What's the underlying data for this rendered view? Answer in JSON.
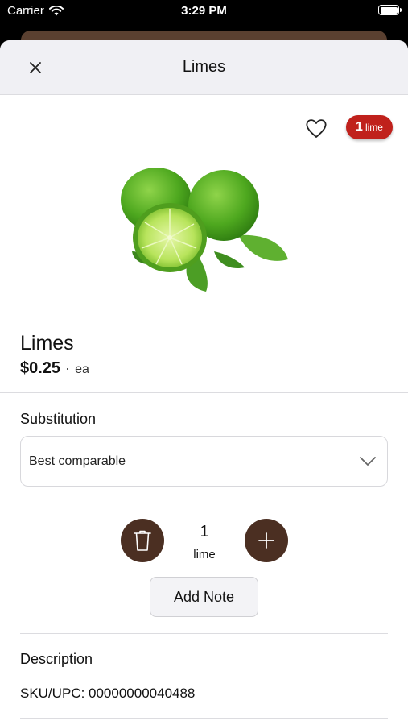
{
  "status_bar": {
    "carrier": "Carrier",
    "time": "3:29 PM"
  },
  "nav": {
    "title": "Limes"
  },
  "cart_badge": {
    "count": "1",
    "unit": "lime",
    "color": "#c0211c"
  },
  "product": {
    "name": "Limes",
    "price": "$0.25",
    "separator": "·",
    "unit": "ea"
  },
  "substitution": {
    "label": "Substitution",
    "selected": "Best comparable"
  },
  "quantity": {
    "value": "1",
    "unit": "lime"
  },
  "add_note_label": "Add Note",
  "description": {
    "label": "Description",
    "sku": "SKU/UPC: 00000000040488"
  },
  "colors": {
    "accent": "#4b2f22",
    "badge": "#c0211c"
  }
}
